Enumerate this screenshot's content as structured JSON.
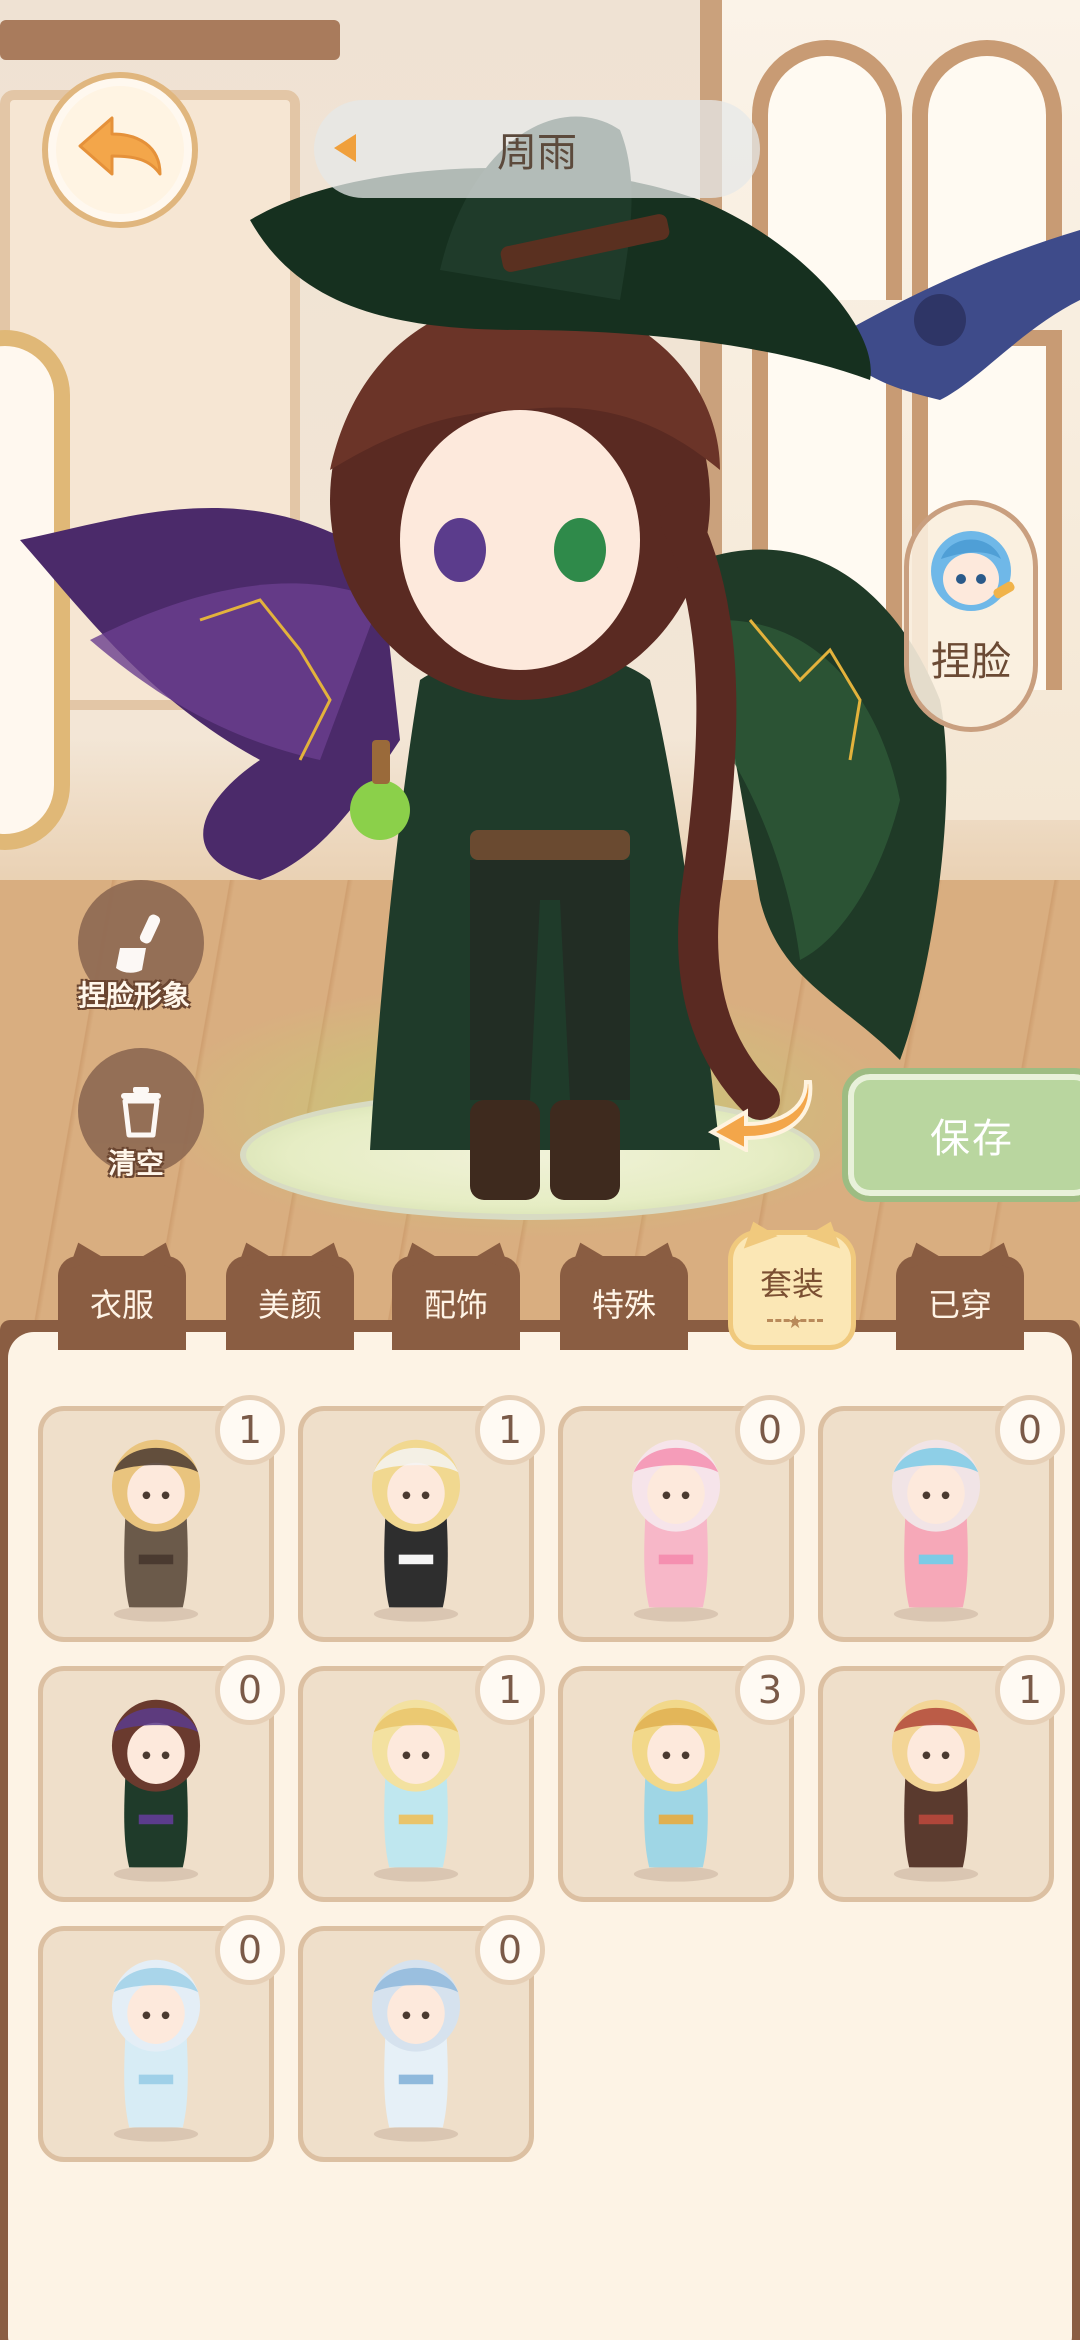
{
  "header": {
    "character_name": "周雨"
  },
  "side_actions": {
    "face_edit_label": "捏脸",
    "face_image_label": "捏脸形象",
    "clear_label": "清空"
  },
  "save_label": "保存",
  "tabs": [
    {
      "label": "衣服",
      "active": false
    },
    {
      "label": "美颜",
      "active": false
    },
    {
      "label": "配饰",
      "active": false
    },
    {
      "label": "特殊",
      "active": false
    },
    {
      "label": "套装",
      "active": true
    },
    {
      "label": "已穿",
      "active": false
    }
  ],
  "outfits": [
    {
      "count": "1",
      "hair": "#e9c47e",
      "outfit": "#6b5a4a",
      "accent": "#4a3a30"
    },
    {
      "count": "1",
      "hair": "#f1d890",
      "outfit": "#2e2e2e",
      "accent": "#f5f5f5"
    },
    {
      "count": "0",
      "hair": "#f6e4ea",
      "outfit": "#f7b7c8",
      "accent": "#f58fb0"
    },
    {
      "count": "0",
      "hair": "#f1e4e6",
      "outfit": "#f6a8b8",
      "accent": "#7ccbe6"
    },
    {
      "count": "0",
      "hair": "#6a3a2e",
      "outfit": "#1f3b2a",
      "accent": "#5b3c8c"
    },
    {
      "count": "1",
      "hair": "#f3e1a0",
      "outfit": "#bfe7ef",
      "accent": "#e9c46a"
    },
    {
      "count": "3",
      "hair": "#f2d88a",
      "outfit": "#9fd6e5",
      "accent": "#e0b050"
    },
    {
      "count": "1",
      "hair": "#f3d596",
      "outfit": "#5a3a2e",
      "accent": "#b0463a"
    },
    {
      "count": "0",
      "hair": "#e4eef6",
      "outfit": "#d7ecf5",
      "accent": "#9fd0e8"
    },
    {
      "count": "0",
      "hair": "#d6e2ee",
      "outfit": "#e6f0f7",
      "accent": "#8fb9dc"
    }
  ],
  "colors": {
    "tab_brown": "#8a5d42",
    "panel_bg": "#fdf3e5",
    "save_green": "#b9d69f",
    "back_orange": "#f3a64a"
  }
}
